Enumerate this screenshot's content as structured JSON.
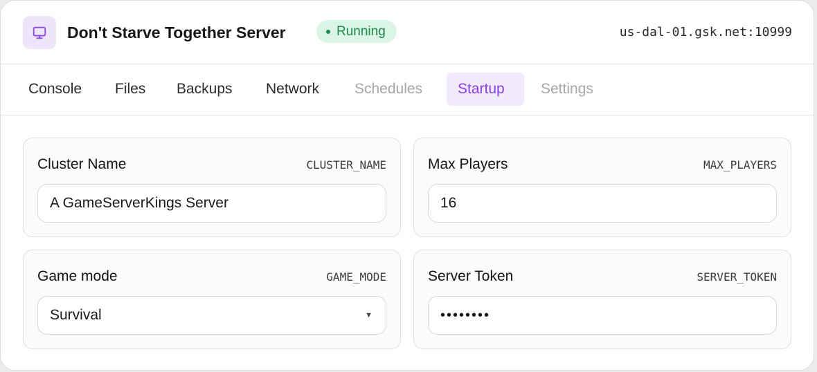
{
  "header": {
    "title": "Don't Starve Together Server",
    "status": "Running",
    "address": "us-dal-01.gsk.net:10999",
    "icon": "monitor-icon"
  },
  "tabs": [
    {
      "label": "Console",
      "state": "normal"
    },
    {
      "label": "Files",
      "state": "normal"
    },
    {
      "label": "Backups",
      "state": "normal"
    },
    {
      "label": "Network",
      "state": "normal"
    },
    {
      "label": "Schedules",
      "state": "disabled"
    },
    {
      "label": "Startup",
      "state": "active"
    },
    {
      "label": "Settings",
      "state": "disabled"
    }
  ],
  "variables": {
    "cluster_name": {
      "label": "Cluster Name",
      "env": "CLUSTER_NAME",
      "value": "A GameServerKings Server"
    },
    "max_players": {
      "label": "Max Players",
      "env": "MAX_PLAYERS",
      "value": "16"
    },
    "game_mode": {
      "label": "Game mode",
      "env": "GAME_MODE",
      "value": "Survival"
    },
    "server_token": {
      "label": "Server Token",
      "env": "SERVER_TOKEN",
      "value": "••••••••"
    }
  },
  "colors": {
    "accent": "#8a3fe0",
    "status_green": "#1f8a4c",
    "status_bg": "#daf5e6"
  }
}
